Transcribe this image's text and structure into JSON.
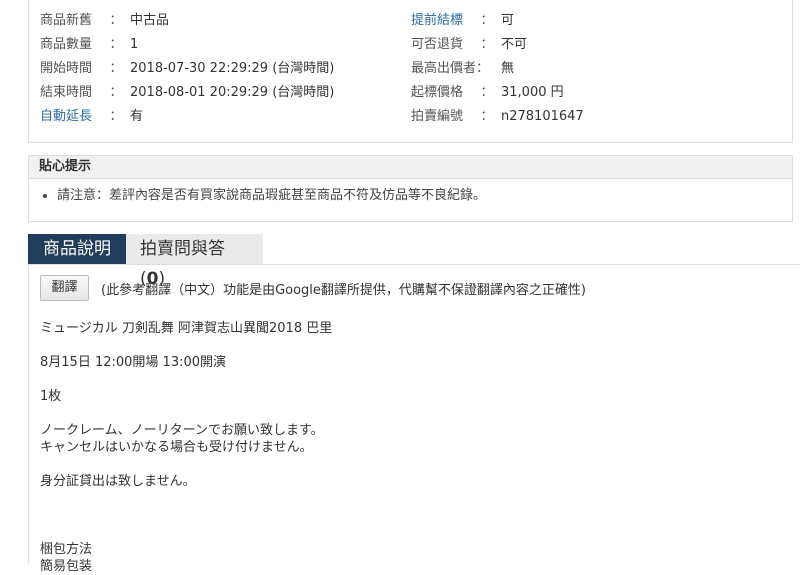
{
  "info": {
    "left": [
      {
        "label": "商品新舊",
        "value": "中古品",
        "link": false
      },
      {
        "label": "商品數量",
        "value": "1",
        "link": false
      },
      {
        "label": "開始時間",
        "value": "2018-07-30 22:29:29 (台灣時間)",
        "link": false
      },
      {
        "label": "結束時間",
        "value": "2018-08-01 20:29:29 (台灣時間)",
        "link": false
      },
      {
        "label": "自動延長",
        "value": "有",
        "link": true
      }
    ],
    "right": [
      {
        "label": "提前結標",
        "value": "可",
        "link": true
      },
      {
        "label": "可否退貨",
        "value": "不可",
        "link": false
      },
      {
        "label": "最高出價者：",
        "value": "無",
        "link": false
      },
      {
        "label": "起標價格",
        "value": "31,000 円",
        "link": false
      },
      {
        "label": "拍賣編號",
        "value": "n278101647",
        "link": false
      }
    ],
    "colon": "："
  },
  "tips": {
    "title": "貼心提示",
    "items": [
      "請注意：差評內容是否有買家說商品瑕疵甚至商品不符及仿品等不良紀錄。"
    ]
  },
  "tabs": {
    "description": "商品說明",
    "qa_label": "拍賣問與答(",
    "qa_count": "0",
    "qa_close": ")"
  },
  "description": {
    "translate_button": "翻譯",
    "translate_note": "(此參考翻譯（中文）功能是由Google翻譯所提供，代購幫不保證翻譯內容之正確性)",
    "lines": [
      "ミュージカル 刀剣乱舞 阿津賀志山異聞2018 巴里",
      "8月15日 12:00開場 13:00開演",
      "1枚",
      "ノークレーム、ノーリターンでお願い致します。",
      "キャンセルはいかなる場合も受け付けません。",
      "身分証貸出は致しません。",
      "梱包方法",
      "簡易包装"
    ]
  }
}
